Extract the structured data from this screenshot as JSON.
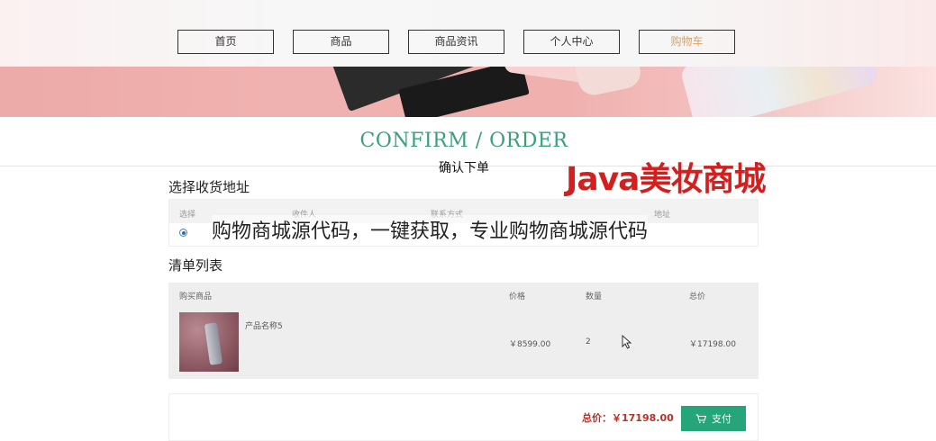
{
  "nav": {
    "items": [
      {
        "label": "首页"
      },
      {
        "label": "商品"
      },
      {
        "label": "商品资讯"
      },
      {
        "label": "个人中心"
      },
      {
        "label": "购物车"
      }
    ]
  },
  "page": {
    "title_en": "CONFIRM / ORDER",
    "title_cn": "确认下单"
  },
  "watermark": {
    "brand": "Java美妆商城",
    "promo": "购物商城源代码，一键获取，专业购物商城源代码"
  },
  "address": {
    "heading": "选择收货地址",
    "columns": [
      "选择",
      "收件人",
      "联系方式",
      "地址"
    ]
  },
  "order_list": {
    "heading": "清单列表",
    "columns": [
      "购买商品",
      "价格",
      "数量",
      "总价"
    ],
    "rows": [
      {
        "name": "产品名称5",
        "price": "￥8599.00",
        "qty": "2",
        "total": "￥17198.00"
      }
    ]
  },
  "summary": {
    "total_label": "总价：￥17198.00",
    "pay_label": "支付"
  },
  "colors": {
    "accent_green": "#27a57a",
    "total_red": "#b7312a",
    "brand_red": "#d41f1f",
    "active_nav": "#e2a15c"
  },
  "icons": {
    "pay": "cart-icon",
    "pointer": "mouse-cursor-icon"
  }
}
